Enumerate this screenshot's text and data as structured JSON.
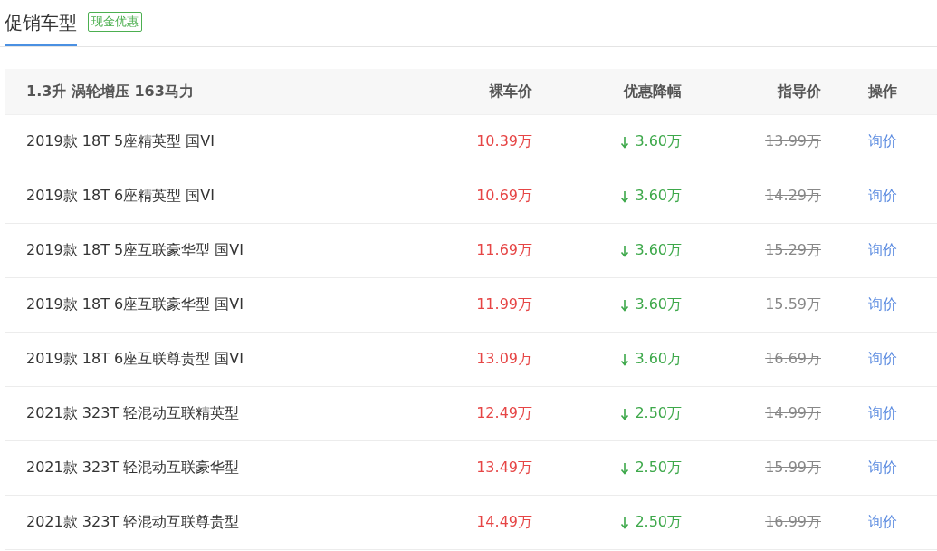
{
  "tab": {
    "title": "促销车型",
    "badge": "现金优惠"
  },
  "table": {
    "group": "1.3升 涡轮增压 163马力",
    "columns": [
      "裸车价",
      "优惠降幅",
      "指导价",
      "操作"
    ],
    "rows": [
      {
        "name": "2019款 18T 5座精英型 国VI",
        "price": "10.39万",
        "discount": "3.60万",
        "guide": "13.99万",
        "action": "询价"
      },
      {
        "name": "2019款 18T 6座精英型 国VI",
        "price": "10.69万",
        "discount": "3.60万",
        "guide": "14.29万",
        "action": "询价"
      },
      {
        "name": "2019款 18T 5座互联豪华型 国VI",
        "price": "11.69万",
        "discount": "3.60万",
        "guide": "15.29万",
        "action": "询价"
      },
      {
        "name": "2019款 18T 6座互联豪华型 国VI",
        "price": "11.99万",
        "discount": "3.60万",
        "guide": "15.59万",
        "action": "询价"
      },
      {
        "name": "2019款 18T 6座互联尊贵型 国VI",
        "price": "13.09万",
        "discount": "3.60万",
        "guide": "16.69万",
        "action": "询价"
      },
      {
        "name": "2021款 323T 轻混动互联精英型",
        "price": "12.49万",
        "discount": "2.50万",
        "guide": "14.99万",
        "action": "询价"
      },
      {
        "name": "2021款 323T 轻混动互联豪华型",
        "price": "13.49万",
        "discount": "2.50万",
        "guide": "15.99万",
        "action": "询价"
      },
      {
        "name": "2021款 323T 轻混动互联尊贵型",
        "price": "14.49万",
        "discount": "2.50万",
        "guide": "16.99万",
        "action": "询价"
      }
    ]
  }
}
